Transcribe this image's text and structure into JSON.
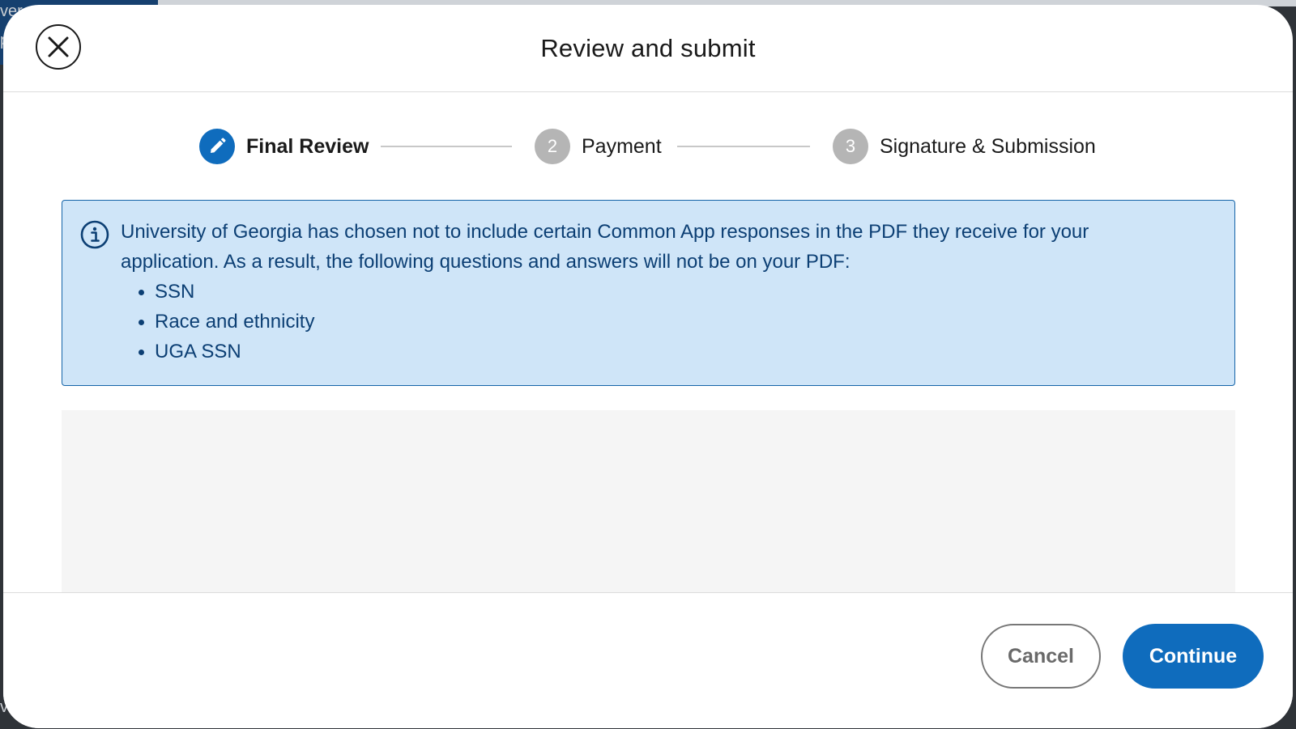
{
  "background": {
    "fragments": [
      "ver",
      "p",
      "ver"
    ]
  },
  "modal": {
    "title": "Review and submit",
    "close_icon": "close-circle-icon"
  },
  "stepper": {
    "steps": [
      {
        "marker": "pencil-icon",
        "label": "Final Review",
        "state": "active"
      },
      {
        "marker": "2",
        "label": "Payment",
        "state": "inactive"
      },
      {
        "marker": "3",
        "label": "Signature & Submission",
        "state": "inactive"
      }
    ]
  },
  "notice": {
    "icon": "info-icon",
    "line1": "University of Georgia has chosen not to include certain Common App responses in the PDF they receive for your",
    "line2": "application. As a result, the following questions and answers will not be on your PDF:",
    "items": [
      "SSN",
      "Race and ethnicity",
      "UGA SSN"
    ]
  },
  "footer": {
    "cancel_label": "Cancel",
    "continue_label": "Continue"
  },
  "colors": {
    "accent": "#0f6cbd",
    "notice_background": "#cfe5f8",
    "notice_text": "#0c3f74",
    "inactive_step": "#b5b5b5"
  }
}
